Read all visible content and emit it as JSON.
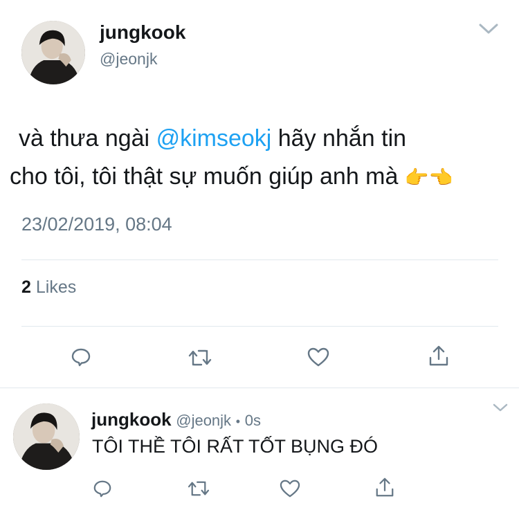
{
  "main_tweet": {
    "display_name": "jungkook",
    "handle": "@jeonjk",
    "text_before": "và thưa ngài",
    "mention": "@kimseokj",
    "text_after_line1": " hãy nhắn tin",
    "text_line2": "cho tôi, tôi thật sự muốn giúp anh mà ",
    "emoji": "👉👈",
    "timestamp": "23/02/2019, 08:04",
    "likes_count": "2",
    "likes_label": "Likes"
  },
  "reply_tweet": {
    "display_name": "jungkook",
    "handle": "@jeonjk",
    "separator": "•",
    "time": "0s",
    "text": "TÔI THỀ TÔI RẤT TỐT BỤNG ĐÓ"
  },
  "icons": {
    "reply": "reply-icon",
    "retweet": "retweet-icon",
    "like": "heart-icon",
    "share": "share-icon",
    "menu": "chevron-down-icon"
  },
  "colors": {
    "accent": "#1da1f2",
    "muted": "#657786",
    "text": "#14171a",
    "divider": "#e1e8ed"
  }
}
